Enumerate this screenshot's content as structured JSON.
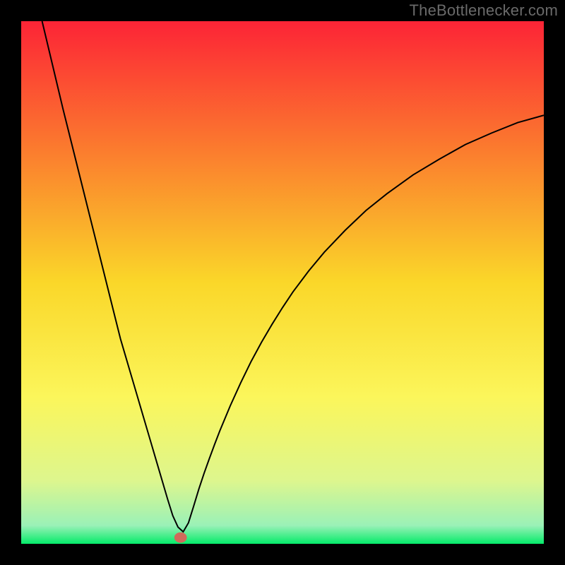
{
  "attribution": "TheBottlenecker.com",
  "chart_data": {
    "type": "line",
    "title": "",
    "xlabel": "",
    "ylabel": "",
    "xlim": [
      0,
      100
    ],
    "ylim": [
      0,
      100
    ],
    "legend": "none",
    "grid": false,
    "background_gradient": {
      "stops": [
        {
          "offset": 0.0,
          "color": "#fc2436"
        },
        {
          "offset": 0.25,
          "color": "#fb7d2e"
        },
        {
          "offset": 0.5,
          "color": "#fad729"
        },
        {
          "offset": 0.72,
          "color": "#fbf65b"
        },
        {
          "offset": 0.88,
          "color": "#ddf68e"
        },
        {
          "offset": 0.965,
          "color": "#9af1b7"
        },
        {
          "offset": 1.0,
          "color": "#05eb6a"
        }
      ]
    },
    "marker": {
      "x": 30.5,
      "y": 1.2,
      "color": "#d06a5b",
      "rx": 1.2,
      "ry": 1.0
    },
    "series": [
      {
        "name": "curve",
        "color": "#000000",
        "stroke_width": 2,
        "x": [
          4,
          5,
          6,
          7,
          8,
          9,
          10,
          11,
          12,
          13,
          14,
          15,
          16,
          17,
          18,
          19,
          20,
          21,
          22,
          23,
          24,
          25,
          26,
          27,
          28,
          29,
          30,
          31,
          32,
          33,
          34,
          35,
          36,
          37,
          38,
          40,
          42,
          44,
          46,
          48,
          50,
          52,
          55,
          58,
          62,
          66,
          70,
          75,
          80,
          85,
          90,
          95,
          100
        ],
        "y": [
          100,
          95.8,
          91.6,
          87.4,
          83.2,
          79.2,
          75.2,
          71.2,
          67.2,
          63.2,
          59.2,
          55.2,
          51.2,
          47.2,
          43.2,
          39.2,
          35.8,
          32.4,
          29.0,
          25.6,
          22.2,
          18.8,
          15.4,
          12.0,
          8.6,
          5.4,
          3.2,
          2.3,
          4.0,
          7.2,
          10.5,
          13.5,
          16.3,
          19.0,
          21.6,
          26.4,
          30.8,
          34.9,
          38.6,
          42.0,
          45.2,
          48.2,
          52.2,
          55.8,
          60.0,
          63.8,
          67.0,
          70.6,
          73.6,
          76.4,
          78.6,
          80.6,
          82.0
        ]
      }
    ]
  }
}
